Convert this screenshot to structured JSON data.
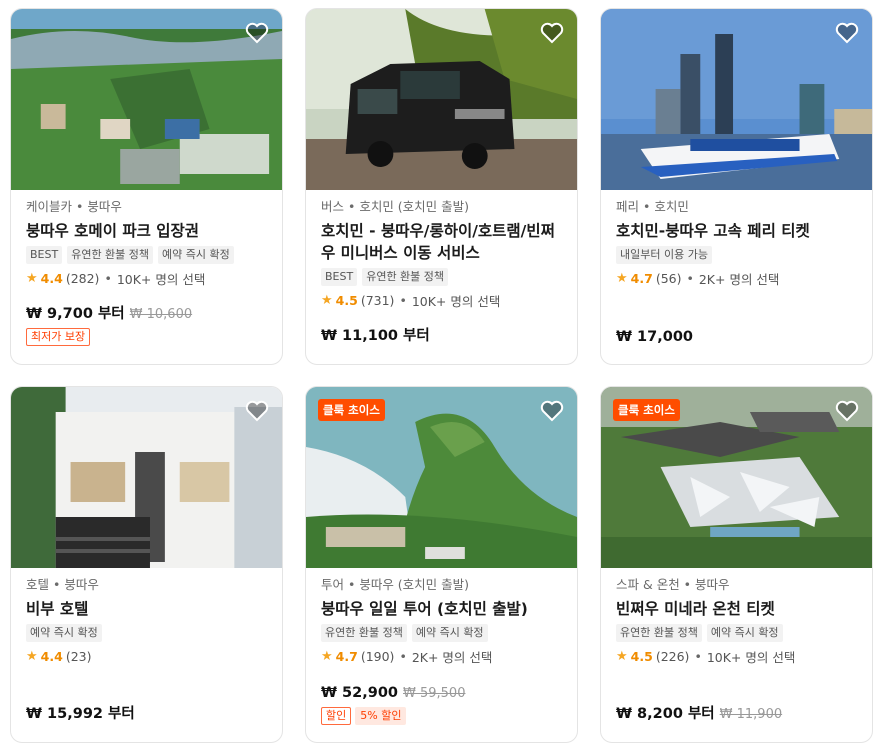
{
  "cards": [
    {
      "category": "케이블카 • 붕따우",
      "title": "붕따우 호메이 파크 입장권",
      "tags": [
        "BEST",
        "유연한 환불 정책",
        "예약 즉시 확정"
      ],
      "rating": "4.4",
      "reviews": "(282)",
      "booked": "10K+ 명의 선택",
      "price": "₩ 9,700 부터",
      "old_price": "₩ 10,600",
      "badge": "최저가 보장"
    },
    {
      "category": "버스 • 호치민 (호치민 출발)",
      "title": "호치민 - 붕따우/롱하이/호트램/빈쩌우 미니버스 이동 서비스",
      "tags": [
        "BEST",
        "유연한 환불 정책"
      ],
      "rating": "4.5",
      "reviews": "(731)",
      "booked": "10K+ 명의 선택",
      "price": "₩ 11,100 부터"
    },
    {
      "category": "페리 • 호치민",
      "title": "호치민-붕따우 고속 페리 티켓",
      "tags": [
        "내일부터 이용 가능"
      ],
      "rating": "4.7",
      "reviews": "(56)",
      "booked": "2K+ 명의 선택",
      "price": "₩ 17,000"
    },
    {
      "category": "호텔 • 붕따우",
      "title": "비부 호텔",
      "tags": [
        "예약 즉시 확정"
      ],
      "rating": "4.4",
      "reviews": "(23)",
      "price": "₩ 15,992 부터"
    },
    {
      "choice": "클룩 초이스",
      "category": "투어 • 붕따우 (호치민 출발)",
      "title": "붕따우 일일 투어 (호치민 출발)",
      "tags": [
        "유연한 환불 정책",
        "예약 즉시 확정"
      ],
      "rating": "4.7",
      "reviews": "(190)",
      "booked": "2K+ 명의 선택",
      "price": "₩ 52,900",
      "old_price": "₩ 59,500",
      "sale_label": "할인",
      "sale_pct": "5% 할인"
    },
    {
      "choice": "클룩 초이스",
      "category": "스파 & 온천 • 붕따우",
      "title": "빈쩌우 미네라 온천 티켓",
      "tags": [
        "유연한 환불 정책",
        "예약 즉시 확정"
      ],
      "rating": "4.5",
      "reviews": "(226)",
      "booked": "10K+ 명의 선택",
      "price": "₩ 8,200 부터",
      "old_price": "₩ 11,900"
    }
  ],
  "icons": {
    "wishlist": "heart-icon",
    "rating": "star-icon"
  },
  "colors": {
    "accent": "#ff4d00",
    "star": "#f5a623",
    "rating_text": "#f08c00"
  }
}
